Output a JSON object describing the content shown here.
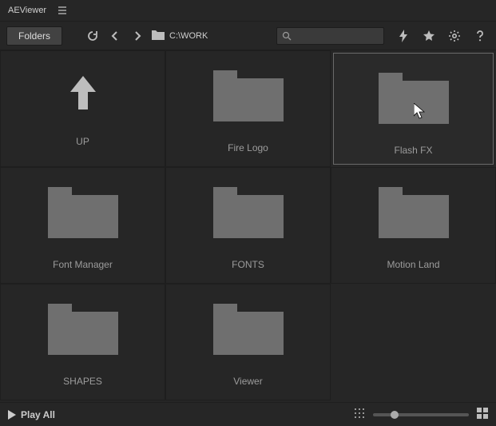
{
  "app": {
    "title": "AEViewer"
  },
  "toolbar": {
    "folders_label": "Folders",
    "path": "C:\\WORK"
  },
  "search": {
    "placeholder": ""
  },
  "items": [
    {
      "label": "UP",
      "type": "up"
    },
    {
      "label": "Fire Logo",
      "type": "folder"
    },
    {
      "label": "Flash FX",
      "type": "folder",
      "selected": true,
      "cursor": true
    },
    {
      "label": "Font Manager",
      "type": "folder"
    },
    {
      "label": "FONTS",
      "type": "folder"
    },
    {
      "label": "Motion Land",
      "type": "folder"
    },
    {
      "label": "SHAPES",
      "type": "folder"
    },
    {
      "label": "Viewer",
      "type": "folder"
    }
  ],
  "footer": {
    "play_label": "Play All"
  }
}
